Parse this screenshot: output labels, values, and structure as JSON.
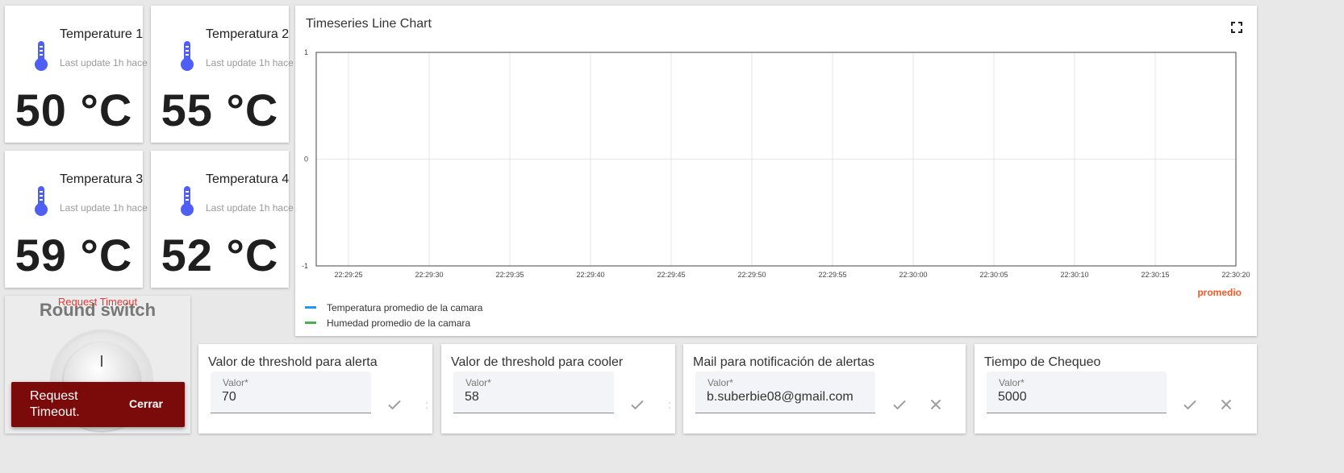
{
  "temperature_cards": [
    {
      "title": "Temperature 1",
      "subtitle": "Last update 1h hace",
      "value": "50 °C"
    },
    {
      "title": "Temperatura 2",
      "subtitle": "Last update 1h hace",
      "value": "55 °C"
    },
    {
      "title": "Temperatura 3",
      "subtitle": "Last update 1h hace",
      "value": "59 °C"
    },
    {
      "title": "Temperatura 4",
      "subtitle": "Last update 1h hace",
      "value": "52 °C"
    }
  ],
  "thermometer_icon": "thermometer-icon",
  "thermometer_color": "#4f5ff5",
  "chart": {
    "title": "Timeseries Line Chart",
    "fullscreen_icon": "fullscreen-icon",
    "aux_label": "promedio",
    "aux_color": "#ff5722"
  },
  "chart_data": {
    "type": "line",
    "title": "Timeseries Line Chart",
    "x_ticks": [
      "22:29:25",
      "22:29:30",
      "22:29:35",
      "22:29:40",
      "22:29:45",
      "22:29:50",
      "22:29:55",
      "22:30:00",
      "22:30:05",
      "22:30:10",
      "22:30:15",
      "22:30:20"
    ],
    "y_ticks": [
      "1",
      "0",
      "-1"
    ],
    "ylim": [
      -1,
      1
    ],
    "grid": true,
    "legend_position": "bottom-left",
    "series": [
      {
        "name": "Temperatura promedio de la camara",
        "color": "#2196f3",
        "values": []
      },
      {
        "name": "Humedad promedio de la camara",
        "color": "#4caf50",
        "values": []
      }
    ]
  },
  "round_switch": {
    "title": "Round switch",
    "error": "Request Timeout",
    "snackbar_text": "Request Timeout.",
    "snackbar_action": "Cerrar",
    "snackbar_color": "#7b0a0a"
  },
  "inputs": [
    {
      "title": "Valor de threshold para alerta",
      "label": "Valor*",
      "value": "70"
    },
    {
      "title": "Valor de threshold para cooler",
      "label": "Valor*",
      "value": "58"
    },
    {
      "title": "Mail para notificación de alertas",
      "label": "Valor*",
      "value": "b.suberbie08@gmail.com"
    },
    {
      "title": "Tiempo de Chequeo",
      "label": "Valor*",
      "value": "5000"
    }
  ],
  "icons": {
    "confirm": "check-icon",
    "cancel": "close-icon"
  }
}
